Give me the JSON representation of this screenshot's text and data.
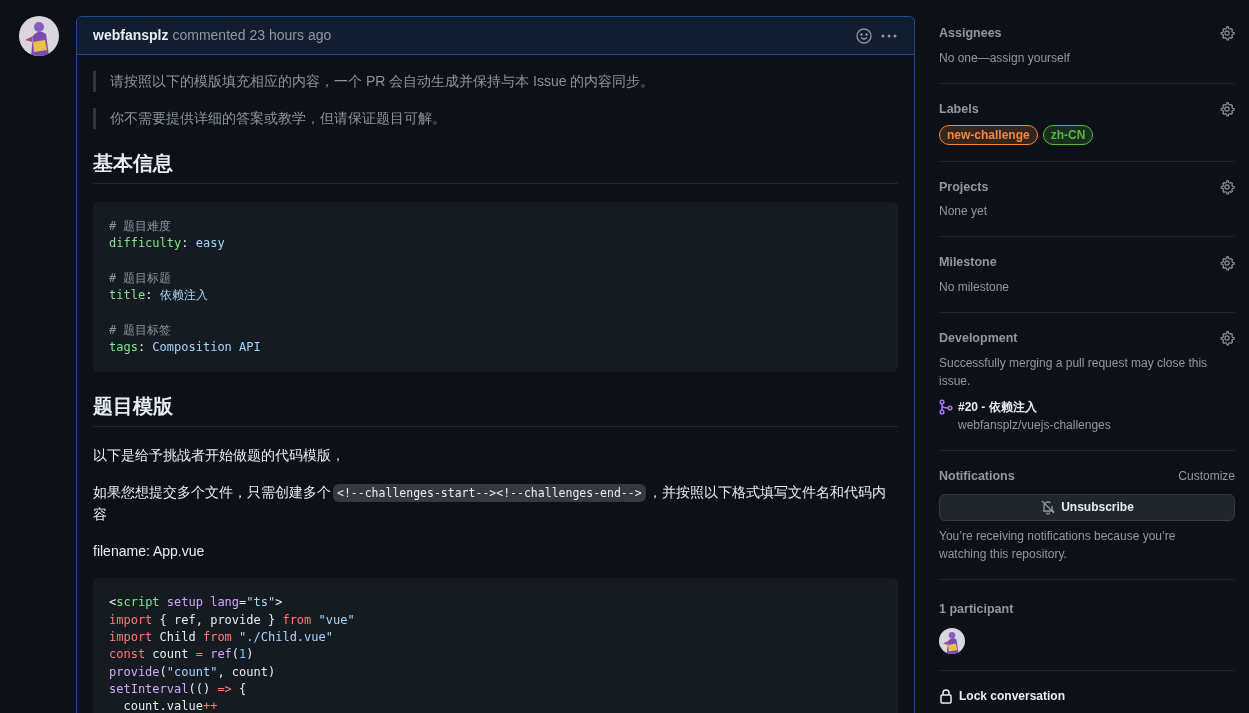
{
  "comment": {
    "author": "webfansplz",
    "action": "commented 23 hours ago",
    "body": [
      {
        "kind": "quote",
        "text": "请按照以下的模版填充相应的内容，一个 PR 会自动生成并保持与本 Issue 的内容同步。"
      },
      {
        "kind": "quote",
        "text": "你不需要提供详细的答案或教学，但请保证题目可解。"
      },
      {
        "kind": "heading",
        "text": "基本信息"
      },
      {
        "kind": "code",
        "groups": [
          [
            [
              {
                "kind": "comment",
                "text": "# 题目难度"
              }
            ],
            [
              {
                "kind": "key",
                "text": "difficulty"
              },
              {
                "kind": "plain",
                "text": ":"
              },
              {
                "kind": "string",
                "text": " easy"
              }
            ]
          ],
          [
            [
              {
                "kind": "comment",
                "text": "# 题目标题"
              }
            ],
            [
              {
                "kind": "key",
                "text": "title"
              },
              {
                "kind": "plain",
                "text": ":"
              },
              {
                "kind": "string",
                "text": " 依赖注入"
              }
            ]
          ],
          [
            [
              {
                "kind": "comment",
                "text": "# 题目标签"
              }
            ],
            [
              {
                "kind": "key",
                "text": "tags"
              },
              {
                "kind": "plain",
                "text": ":"
              },
              {
                "kind": "string",
                "text": " Composition API"
              }
            ]
          ]
        ]
      },
      {
        "kind": "heading",
        "text": "题目模版"
      },
      {
        "kind": "paragraph",
        "segments": [
          {
            "kind": "text",
            "text": "以下是给予挑战者开始做题的代码模版，"
          }
        ]
      },
      {
        "kind": "paragraph",
        "segments": [
          {
            "kind": "text",
            "text": "如果您想提交多个文件，只需创建多个"
          },
          {
            "kind": "code",
            "text": "<!--challenges-start--><!--challenges-end-->"
          },
          {
            "kind": "text",
            "text": "，并按照以下格式填写文件名和代码内容"
          }
        ]
      },
      {
        "kind": "paragraph",
        "segments": [
          {
            "kind": "text",
            "text": "filename: App.vue"
          }
        ]
      },
      {
        "kind": "code",
        "groups": [
          [
            [
              {
                "kind": "plain",
                "text": "<"
              },
              {
                "kind": "key",
                "text": "script"
              },
              {
                "kind": "attr",
                "text": " setup lang"
              },
              {
                "kind": "plain",
                "text": "="
              },
              {
                "kind": "string",
                "text": "\"ts\""
              },
              {
                "kind": "plain",
                "text": ">"
              }
            ],
            [
              {
                "kind": "keyword",
                "text": "import"
              },
              {
                "kind": "plain",
                "text": " { ref, provide } "
              },
              {
                "kind": "keyword",
                "text": "from"
              },
              {
                "kind": "string",
                "text": " \"vue\""
              }
            ],
            [
              {
                "kind": "keyword",
                "text": "import"
              },
              {
                "kind": "plain",
                "text": " Child "
              },
              {
                "kind": "keyword",
                "text": "from"
              },
              {
                "kind": "string",
                "text": " \"./Child.vue\""
              }
            ],
            [
              {
                "kind": "keyword",
                "text": "const"
              },
              {
                "kind": "plain",
                "text": " count "
              },
              {
                "kind": "keyword",
                "text": "="
              },
              {
                "kind": "attr",
                "text": " ref"
              },
              {
                "kind": "plain",
                "text": "("
              },
              {
                "kind": "number",
                "text": "1"
              },
              {
                "kind": "plain",
                "text": ")"
              }
            ],
            [
              {
                "kind": "attr",
                "text": "provide"
              },
              {
                "kind": "plain",
                "text": "("
              },
              {
                "kind": "string",
                "text": "\"count\""
              },
              {
                "kind": "plain",
                "text": ", count)"
              }
            ],
            [
              {
                "kind": "attr",
                "text": "setInterval"
              },
              {
                "kind": "plain",
                "text": "(() "
              },
              {
                "kind": "keyword",
                "text": "=>"
              },
              {
                "kind": "plain",
                "text": " {"
              }
            ],
            [
              {
                "kind": "plain",
                "text": "  count.value"
              },
              {
                "kind": "keyword",
                "text": "++"
              }
            ]
          ]
        ]
      }
    ]
  },
  "sidebar": [
    {
      "kind": "text",
      "title": "Assignees",
      "value": "No one—assign yourself"
    },
    {
      "kind": "labels",
      "title": "Labels",
      "labels": [
        {
          "text": "new-challenge",
          "color": "#f0883e"
        },
        {
          "text": "zh-CN",
          "color": "#56b93e"
        }
      ]
    },
    {
      "kind": "text",
      "title": "Projects",
      "value": "None yet"
    },
    {
      "kind": "text",
      "title": "Milestone",
      "value": "No milestone"
    },
    {
      "kind": "development",
      "title": "Development",
      "value": "Successfully merging a pull request may close this issue.",
      "link": "#20 - 依赖注入",
      "repo": "webfansplz/vuejs-challenges"
    },
    {
      "kind": "notifications",
      "title": "Notifications",
      "action": "Customize",
      "button": "Unsubscribe",
      "value": "You’re receiving notifications because you’re watching this repository."
    },
    {
      "kind": "participants",
      "title": "1 participant"
    },
    {
      "kind": "lock",
      "title": "Lock conversation"
    }
  ]
}
